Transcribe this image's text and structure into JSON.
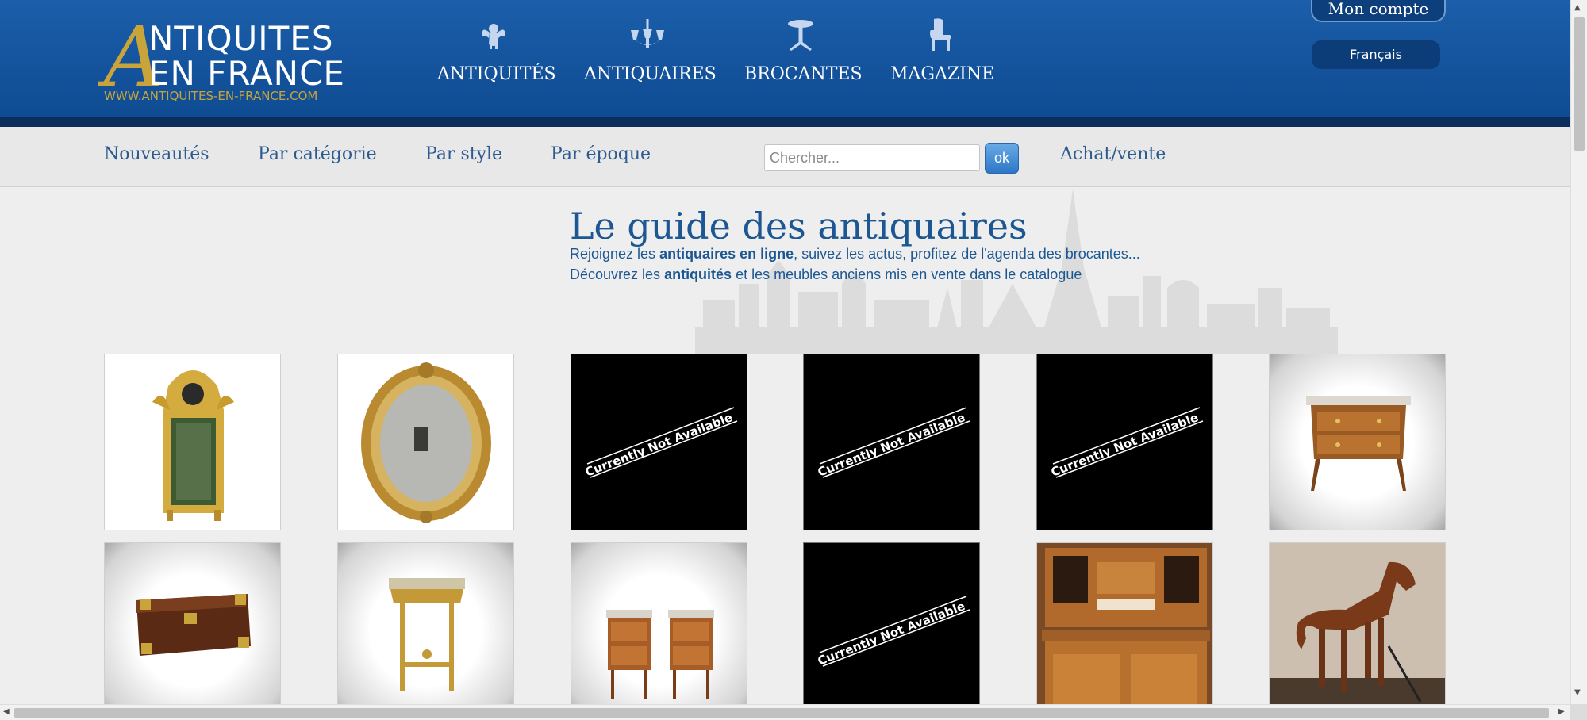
{
  "logo": {
    "line1": "NTIQUITES",
    "line2": "EN FRANCE",
    "letter": "A",
    "url": "WWW.ANTIQUITES-EN-FRANCE.COM"
  },
  "main_nav": [
    {
      "label": "ANTIQUITÉS",
      "icon": "cherub-icon"
    },
    {
      "label": "ANTIQUAIRES",
      "icon": "chandelier-icon"
    },
    {
      "label": "BROCANTES",
      "icon": "pedestal-table-icon"
    },
    {
      "label": "MAGAZINE",
      "icon": "armchair-icon"
    }
  ],
  "account": {
    "label": "Mon compte"
  },
  "language": {
    "label": "Français"
  },
  "sub_nav": {
    "links": [
      "Nouveautés",
      "Par catégorie",
      "Par style",
      "Par époque",
      "Achat/vente"
    ],
    "search_placeholder": "Chercher...",
    "search_button": "ok"
  },
  "hero": {
    "title": "Le guide des antiquaires",
    "line1_pre": "Rejoignez les ",
    "line1_bold": "antiquaires en ligne",
    "line1_post": ", suivez les actus, profitez de l'agenda des brocantes...",
    "line2_pre": "Découvrez les ",
    "line2_bold": "antiquités",
    "line2_post": " et les meubles anciens mis en vente dans le catalogue"
  },
  "unavailable_text": "Currently Not Available",
  "products": [
    {
      "kind": "gilded-mirror-louis-xvi"
    },
    {
      "kind": "oval-gilded-mirror"
    },
    {
      "kind": "unavailable"
    },
    {
      "kind": "unavailable"
    },
    {
      "kind": "unavailable"
    },
    {
      "kind": "marble-top-commode"
    },
    {
      "kind": "campaign-chest"
    },
    {
      "kind": "gilded-console"
    },
    {
      "kind": "pair-bedside-tables"
    },
    {
      "kind": "unavailable"
    },
    {
      "kind": "oak-buffet-cabinet"
    },
    {
      "kind": "carousel-horse"
    }
  ],
  "colors": {
    "header_blue": "#1c5eaa",
    "gold": "#c9a43b",
    "link_blue": "#2c5a8f",
    "title_blue": "#1d5793"
  }
}
